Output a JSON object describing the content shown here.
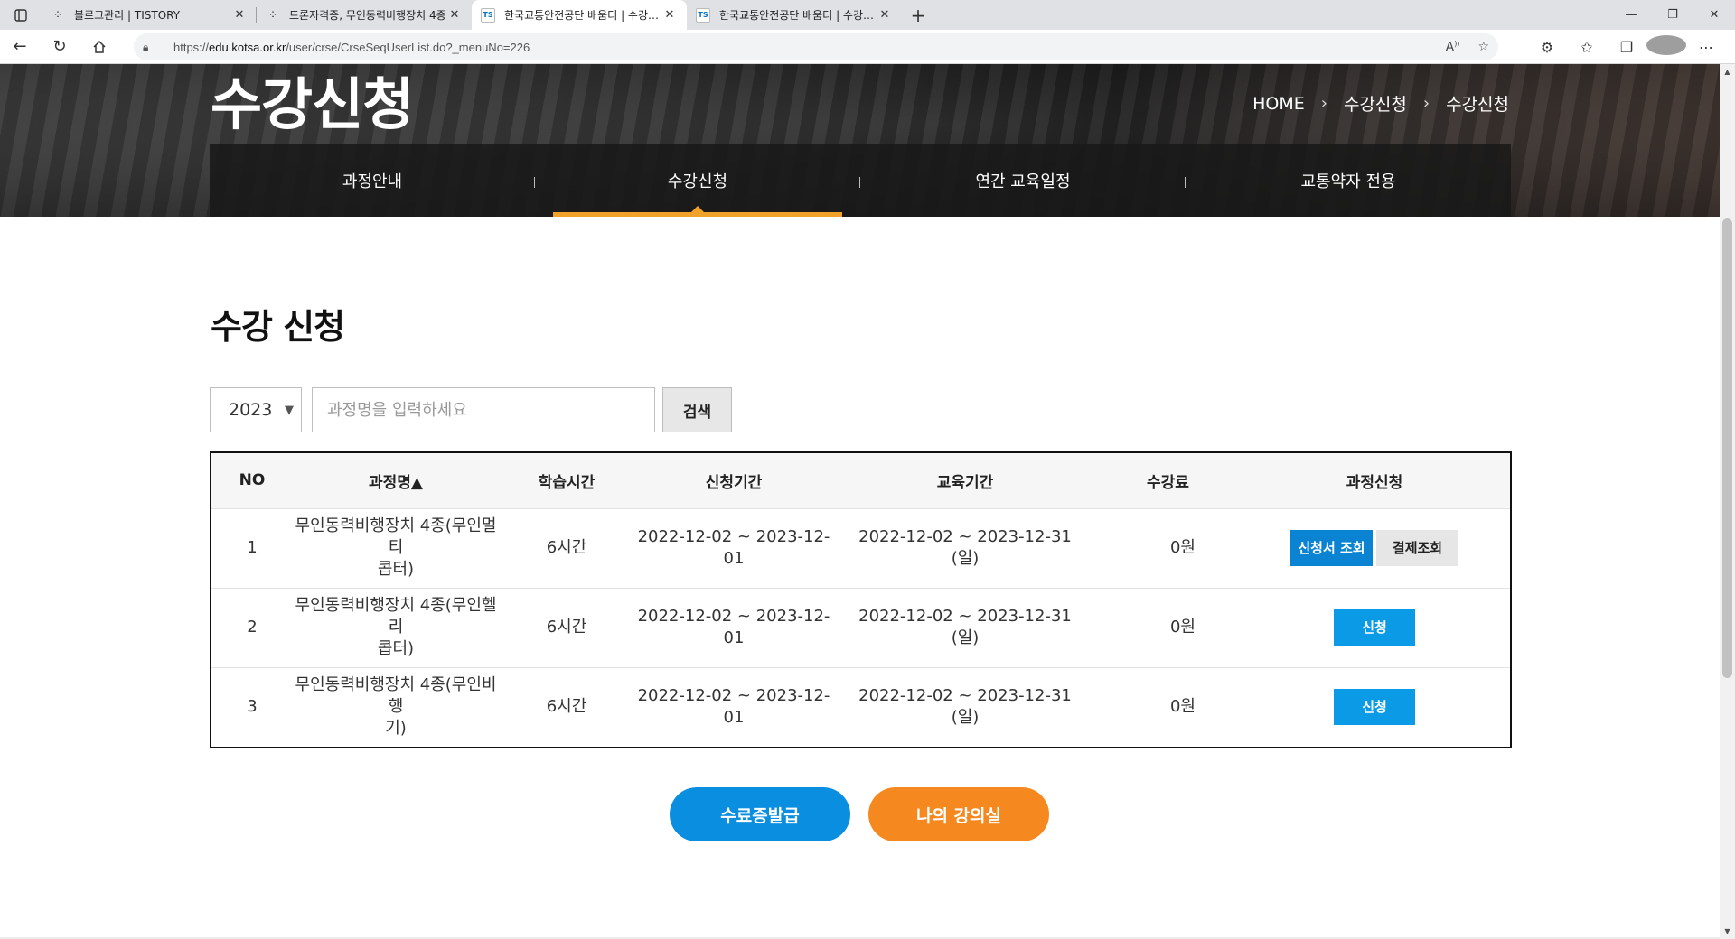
{
  "browser": {
    "tabs": [
      {
        "title": "블로그관리 | TISTORY",
        "favicon": "tistory-icon",
        "active": false
      },
      {
        "title": "드론자격증, 무인동력비행장치 4종",
        "favicon": "tistory-icon",
        "active": false
      },
      {
        "title": "한국교통안전공단 배움터 | 수강신청",
        "favicon": "ts",
        "active": true
      },
      {
        "title": "한국교통안전공단 배움터 | 수강신청",
        "favicon": "ts",
        "active": false
      }
    ],
    "favicon_ts_text": "TS",
    "url_prefix": "https://",
    "url_domain": "edu.kotsa.or.kr",
    "url_path": "/user/crse/CrseSeqUserList.do?_menuNo=226"
  },
  "hero": {
    "title": "수강신청",
    "breadcrumb": [
      "HOME",
      "수강신청",
      "수강신청"
    ]
  },
  "subnav": {
    "items": [
      {
        "label": "과정안내",
        "active": false
      },
      {
        "label": "수강신청",
        "active": true
      },
      {
        "label": "연간 교육일정",
        "active": false
      },
      {
        "label": "교통약자 전용",
        "active": false
      }
    ]
  },
  "section": {
    "title": "수강 신청"
  },
  "search": {
    "year": "2023",
    "placeholder": "과정명을 입력하세요",
    "button_label": "검색"
  },
  "table": {
    "headers": [
      "NO",
      "과정명▲",
      "학습시간",
      "신청기간",
      "교육기간",
      "수강료",
      "과정신청"
    ],
    "rows": [
      {
        "no": "1",
        "name_line1": "무인동력비행장치 4종(무인멀티",
        "name_line2": "콥터)",
        "hours": "6시간",
        "apply_period": "2022-12-02 ~ 2023-12-01",
        "edu_period_line1": "2022-12-02 ~ 2023-12-31",
        "edu_period_line2": "(일)",
        "fee": "0원",
        "actions": [
          "신청서 조회",
          "결제조회"
        ]
      },
      {
        "no": "2",
        "name_line1": "무인동력비행장치 4종(무인헬리",
        "name_line2": "콥터)",
        "hours": "6시간",
        "apply_period": "2022-12-02 ~ 2023-12-01",
        "edu_period_line1": "2022-12-02 ~ 2023-12-31",
        "edu_period_line2": "(일)",
        "fee": "0원",
        "actions": [
          "신청"
        ]
      },
      {
        "no": "3",
        "name_line1": "무인동력비행장치 4종(무인비행",
        "name_line2": "기)",
        "hours": "6시간",
        "apply_period": "2022-12-02 ~ 2023-12-01",
        "edu_period_line1": "2022-12-02 ~ 2023-12-31",
        "edu_period_line2": "(일)",
        "fee": "0원",
        "actions": [
          "신청"
        ]
      }
    ]
  },
  "buttons": {
    "certificate": "수료증발급",
    "my_classroom": "나의 강의실"
  },
  "colors": {
    "accent_orange": "#f0a22a",
    "blue": "#0a8ee0",
    "orange": "#f5891f"
  }
}
